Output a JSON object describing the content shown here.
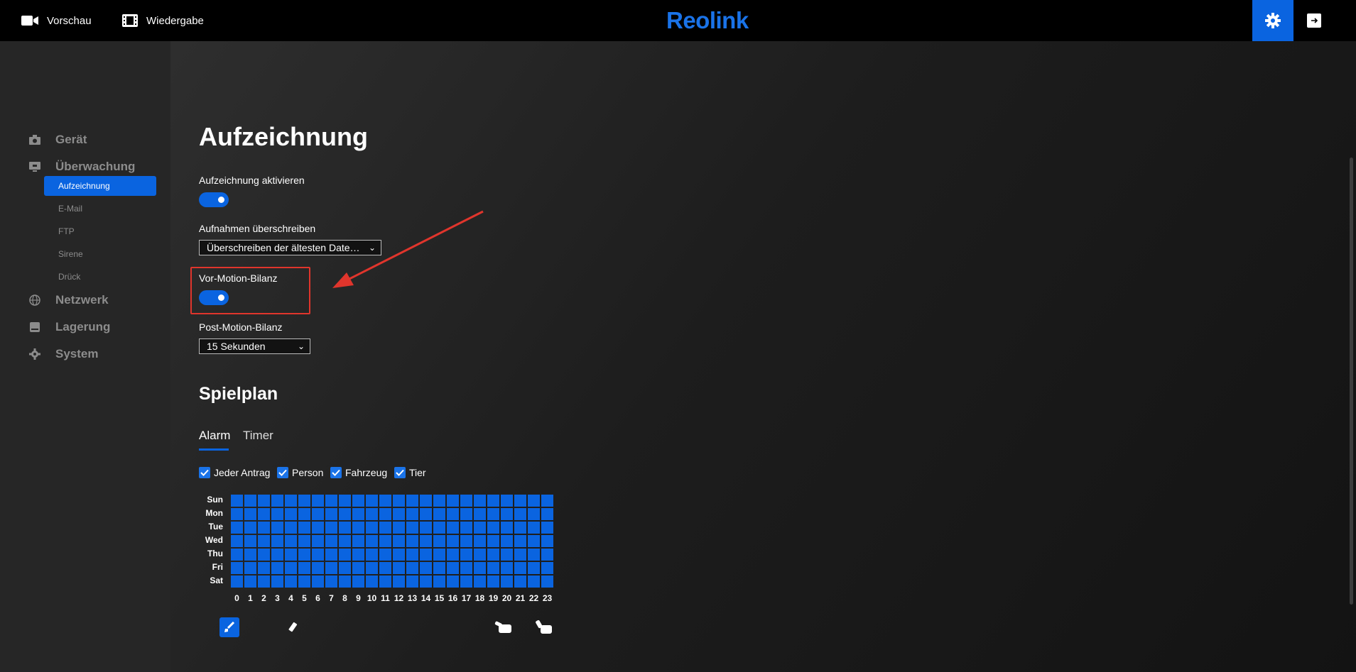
{
  "topbar": {
    "preview_label": "Vorschau",
    "playback_label": "Wiedergabe",
    "logo": "Reolink"
  },
  "sidebar": {
    "categories": [
      {
        "label": "Gerät",
        "icon": "camera-icon"
      },
      {
        "label": "Überwachung",
        "icon": "monitor-icon"
      },
      {
        "label": "Netzwerk",
        "icon": "globe-icon"
      },
      {
        "label": "Lagerung",
        "icon": "storage-icon"
      },
      {
        "label": "System",
        "icon": "gear-icon"
      }
    ],
    "subitems": [
      "Aufzeichnung",
      "E-Mail",
      "FTP",
      "Sirene",
      "Drück"
    ],
    "active_subitem": "Aufzeichnung"
  },
  "page": {
    "title": "Aufzeichnung",
    "record_enable_label": "Aufzeichnung aktivieren",
    "record_enable_on": true,
    "overwrite_label": "Aufnahmen überschreiben",
    "overwrite_value": "Überschreiben der ältesten Date…",
    "pre_motion_label": "Vor-Motion-Bilanz",
    "pre_motion_on": true,
    "post_motion_label": "Post-Motion-Bilanz",
    "post_motion_value": "15 Sekunden"
  },
  "schedule": {
    "title": "Spielplan",
    "tabs": [
      "Alarm",
      "Timer"
    ],
    "active_tab": "Alarm",
    "filters": [
      {
        "label": "Jeder Antrag",
        "checked": true
      },
      {
        "label": "Person",
        "checked": true
      },
      {
        "label": "Fahrzeug",
        "checked": true
      },
      {
        "label": "Tier",
        "checked": true
      }
    ],
    "days": [
      "Sun",
      "Mon",
      "Tue",
      "Wed",
      "Thu",
      "Fri",
      "Sat"
    ],
    "hours": [
      "0",
      "1",
      "2",
      "3",
      "4",
      "5",
      "6",
      "7",
      "8",
      "9",
      "10",
      "11",
      "12",
      "13",
      "14",
      "15",
      "16",
      "17",
      "18",
      "19",
      "20",
      "21",
      "22",
      "23"
    ],
    "all_cells_selected": true
  },
  "colors": {
    "accent": "#0a64e0",
    "highlight_annotation": "#e0352c"
  }
}
